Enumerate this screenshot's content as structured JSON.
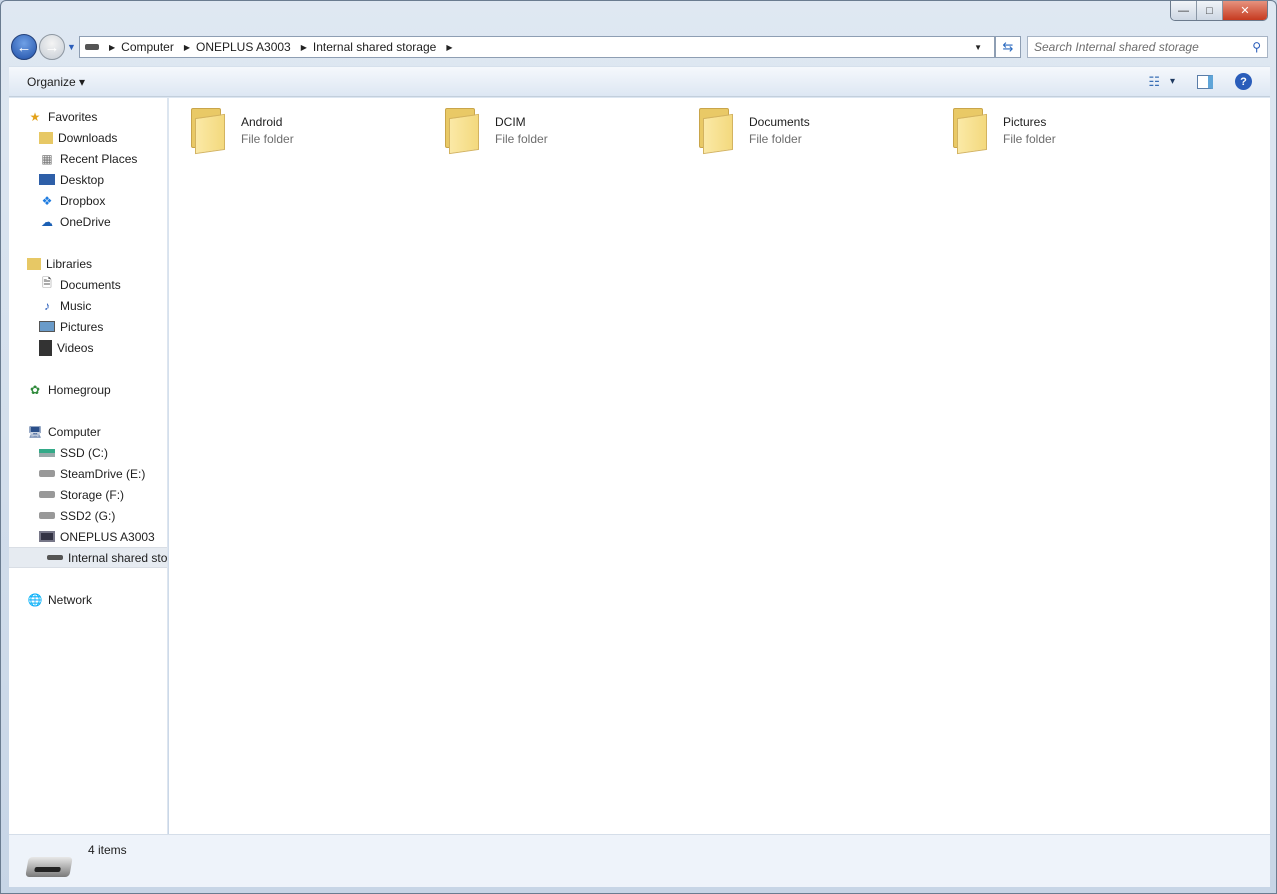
{
  "window": {
    "minimize": "—",
    "maximize": "□",
    "close": "✕"
  },
  "address": {
    "crumbs": [
      "Computer",
      "ONEPLUS A3003",
      "Internal shared storage"
    ]
  },
  "search": {
    "placeholder": "Search Internal shared storage"
  },
  "toolbar": {
    "organize": "Organize ▾",
    "view_arrow": "▾"
  },
  "sidebar": {
    "favorites": {
      "label": "Favorites",
      "items": [
        "Downloads",
        "Recent Places",
        "Desktop",
        "Dropbox",
        "OneDrive"
      ]
    },
    "libraries": {
      "label": "Libraries",
      "items": [
        "Documents",
        "Music",
        "Pictures",
        "Videos"
      ]
    },
    "homegroup": "Homegroup",
    "computer": {
      "label": "Computer",
      "items": [
        "SSD (C:)",
        "SteamDrive (E:)",
        "Storage (F:)",
        "SSD2 (G:)",
        "ONEPLUS A3003"
      ],
      "selected": "Internal shared sto"
    },
    "network": "Network"
  },
  "folders": [
    {
      "name": "Android",
      "type": "File folder"
    },
    {
      "name": "DCIM",
      "type": "File folder"
    },
    {
      "name": "Documents",
      "type": "File folder"
    },
    {
      "name": "Pictures",
      "type": "File folder"
    }
  ],
  "status": {
    "count": "4 items"
  }
}
